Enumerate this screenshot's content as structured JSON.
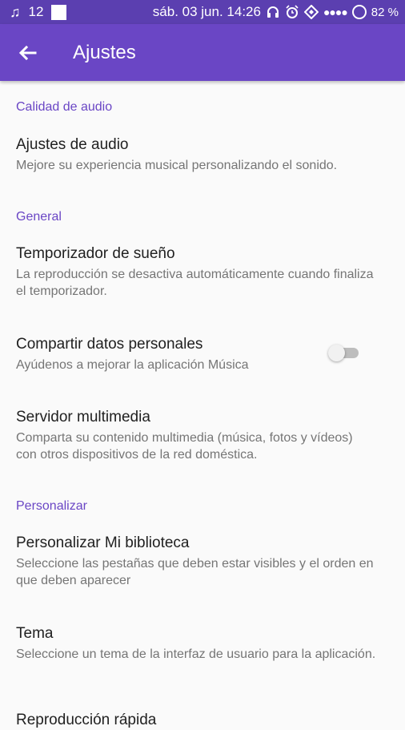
{
  "status_bar": {
    "signal_text": "12",
    "date_time": "sáb. 03 jun. 14:26",
    "battery": "82 %"
  },
  "app_bar": {
    "title": "Ajustes"
  },
  "sections": [
    {
      "header": "Calidad de audio",
      "items": [
        {
          "title": "Ajustes de audio",
          "summary": "Mejore su experiencia musical personalizando el sonido."
        }
      ]
    },
    {
      "header": "General",
      "items": [
        {
          "title": "Temporizador de sueño",
          "summary": "La reproducción se desactiva automáticamente cuando finaliza el temporizador."
        },
        {
          "title": "Compartir datos personales",
          "summary": "Ayúdenos a mejorar la aplicación Música",
          "toggle_on": false
        },
        {
          "title": "Servidor multimedia",
          "summary": "Comparta su contenido multimedia (música, fotos y vídeos) con otros dispositivos de la red doméstica."
        }
      ]
    },
    {
      "header": "Personalizar",
      "items": [
        {
          "title": "Personalizar Mi biblioteca",
          "summary": "Seleccione las pestañas que deben estar visibles y el orden en que deben aparecer"
        },
        {
          "title": "Tema",
          "summary": "Seleccione un tema de la interfaz de usuario para la aplicación."
        },
        {
          "title": "Reproducción rápida"
        }
      ]
    }
  ],
  "colors": {
    "status_bar": "#5b3fb0",
    "app_bar": "#6a46c5",
    "accent": "#6a46c5",
    "title_text": "#212121",
    "summary_text": "#757575",
    "background": "#fafafa"
  }
}
